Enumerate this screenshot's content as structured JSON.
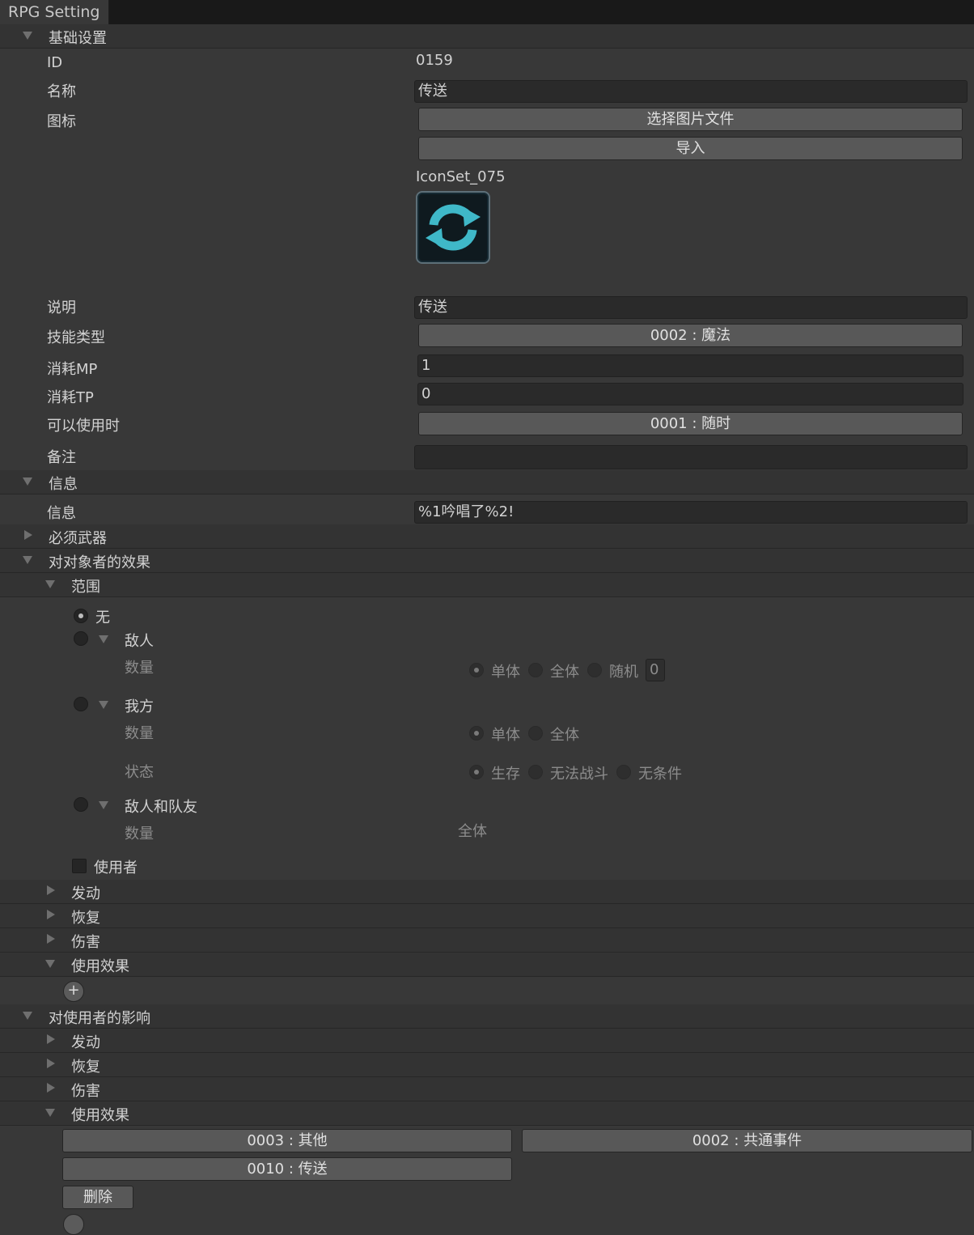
{
  "window": {
    "tab_title": "RPG Setting"
  },
  "basic": {
    "section": "基础设置",
    "id_label": "ID",
    "id_value": "0159",
    "name_label": "名称",
    "name_value": "传送",
    "icon_label": "图标",
    "select_image_button": "选择图片文件",
    "import_button": "导入",
    "icon_name": "IconSet_075",
    "icon_symbol": "refresh-arrows-icon",
    "desc_label": "说明",
    "desc_value": "传送",
    "skill_type_label": "技能类型",
    "skill_type_value": "0002 : 魔法",
    "mp_label": "消耗MP",
    "mp_value": "1",
    "tp_label": "消耗TP",
    "tp_value": "0",
    "usable_label": "可以使用时",
    "usable_value": "0001 : 随时",
    "note_label": "备注",
    "note_value": ""
  },
  "info": {
    "section": "信息",
    "message_label": "信息",
    "message_value": "%1吟唱了%2!"
  },
  "required_weapon": {
    "section": "必须武器"
  },
  "target_effect": {
    "section": "对对象者的效果",
    "range": {
      "section": "范围",
      "none": "无",
      "enemy": {
        "label": "敌人",
        "count_label": "数量",
        "single": "单体",
        "all": "全体",
        "random": "随机",
        "random_count": "0"
      },
      "ally": {
        "label": "我方",
        "count_label": "数量",
        "single": "单体",
        "all": "全体",
        "state_label": "状态",
        "alive": "生存",
        "dead": "无法战斗",
        "any": "无条件"
      },
      "both": {
        "label": "敌人和队友",
        "count_label": "数量",
        "count_value": "全体"
      },
      "user": "使用者"
    },
    "activate": "发动",
    "recover": "恢复",
    "damage": "伤害",
    "use_effect": "使用效果",
    "add_button": "+"
  },
  "user_effect": {
    "section": "对使用者的影响",
    "activate": "发动",
    "recover": "恢复",
    "damage": "伤害",
    "use_effect": "使用效果",
    "effect_other": "0003 : 其他",
    "effect_common_event": "0002 : 共通事件",
    "effect_teleport": "0010 : 传送",
    "delete_button": "删除"
  },
  "colors": {
    "background": "#383838",
    "field": "#2a2a2a",
    "button": "#585858",
    "icon_accent": "#3fb8c8"
  }
}
